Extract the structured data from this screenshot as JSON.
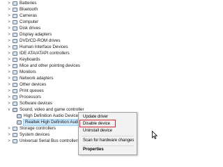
{
  "tree": {
    "items": [
      {
        "label": "Batteries",
        "expand": ">"
      },
      {
        "label": "Bluetooth",
        "expand": ">"
      },
      {
        "label": "Cameras",
        "expand": ">"
      },
      {
        "label": "Computer",
        "expand": ">"
      },
      {
        "label": "Disk drives",
        "expand": ">"
      },
      {
        "label": "Display adapters",
        "expand": ">"
      },
      {
        "label": "DVD/CD-ROM drives",
        "expand": ">"
      },
      {
        "label": "Human Interface Devices",
        "expand": ">"
      },
      {
        "label": "IDE ATA/ATAPI controllers",
        "expand": ">"
      },
      {
        "label": "Keyboards",
        "expand": ">"
      },
      {
        "label": "Mice and other pointing devices",
        "expand": ">"
      },
      {
        "label": "Monitors",
        "expand": ">"
      },
      {
        "label": "Network adapters",
        "expand": ">"
      },
      {
        "label": "Other devices",
        "expand": ">"
      },
      {
        "label": "Print queues",
        "expand": ">"
      },
      {
        "label": "Processors",
        "expand": ">"
      },
      {
        "label": "Software devices",
        "expand": ">"
      },
      {
        "label": "Sound, video and game controller",
        "expand": "v"
      },
      {
        "label": "High Definition Audio Device",
        "expand": ""
      },
      {
        "label": "Realtek High Definition Audio",
        "expand": ""
      },
      {
        "label": "Storage controllers",
        "expand": ">"
      },
      {
        "label": "System devices",
        "expand": ">"
      },
      {
        "label": "Universal Serial Bus controllers",
        "expand": ">"
      }
    ]
  },
  "context_menu": {
    "items": [
      "Update driver",
      "Disable device",
      "Uninstall device",
      "Scan for hardware changes",
      "Properties"
    ],
    "highlighted": "Disable device",
    "highlight_color": "#d0262f"
  },
  "colors": {
    "selection": "#cce8ff",
    "menu_bg": "#f2f2f2"
  }
}
